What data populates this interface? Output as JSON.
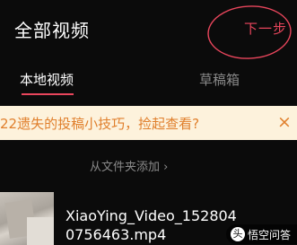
{
  "header": {
    "title": "全部视频",
    "next_label": "下一步"
  },
  "tabs": [
    {
      "label": "本地视频",
      "active": true
    },
    {
      "label": "草稿箱",
      "active": false
    }
  ],
  "tip": {
    "text": "22遗失的投稿小技巧，捡起查看?",
    "close": "×"
  },
  "add_from_folder": "从文件夹添加 ›",
  "videos": [
    {
      "filename": "XiaoYing_Video_1528040756463.mp4"
    }
  ],
  "watermark": {
    "text": "悟空问答",
    "icon": "头"
  },
  "colors": {
    "accent": "#e9465c",
    "tip_bg": "#fdf2dc",
    "tip_text": "#e07f2c",
    "background": "#0b0b0b",
    "muted_text": "#8a8a8a"
  }
}
